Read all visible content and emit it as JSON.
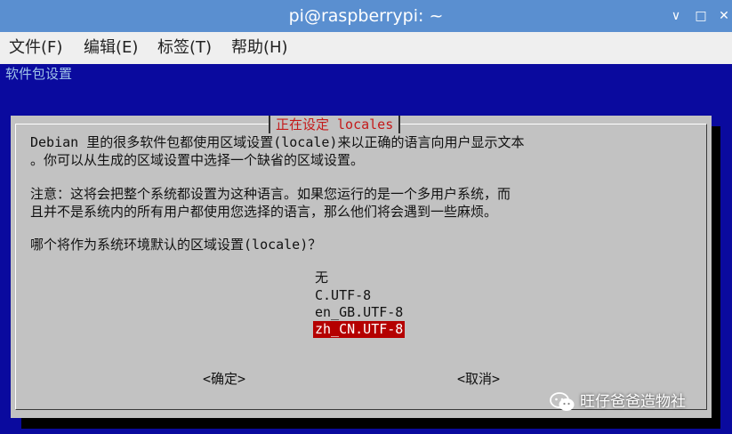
{
  "window": {
    "title": "pi@raspberrypi: ~",
    "minimize_glyph": "∨",
    "maximize_glyph": "□",
    "close_glyph": "✕"
  },
  "menu": [
    "文件(F)",
    "编辑(E)",
    "标签(T)",
    "帮助(H)"
  ],
  "terminal": {
    "header": "软件包设置",
    "dialog": {
      "title": "正在设定 locales",
      "paragraphs": [
        "Debian 里的很多软件包都使用区域设置(locale)来以正确的语言向用户显示文本",
        "。你可以从生成的区域设置中选择一个缺省的区域设置。",
        "注意：这将会把整个系统都设置为这种语言。如果您运行的是一个多用户系统，而",
        "且并不是系统内的所有用户都使用您选择的语言，那么他们将会遇到一些麻烦。",
        "哪个将作为系统环境默认的区域设置(locale)？"
      ],
      "options": [
        "无",
        "C.UTF-8",
        "en_GB.UTF-8",
        "zh_CN.UTF-8"
      ],
      "selected_option": "zh_CN.UTF-8",
      "ok_label": "<确定>",
      "cancel_label": "<取消>"
    }
  },
  "watermark": "旺仔爸爸造物社",
  "colors": {
    "titlebar": "#5a8fd0",
    "terminal_bg": "#0a0a9e",
    "dialog_bg": "#c2c2c2",
    "title_text": "#c41a1a",
    "selection": "#b50000"
  }
}
